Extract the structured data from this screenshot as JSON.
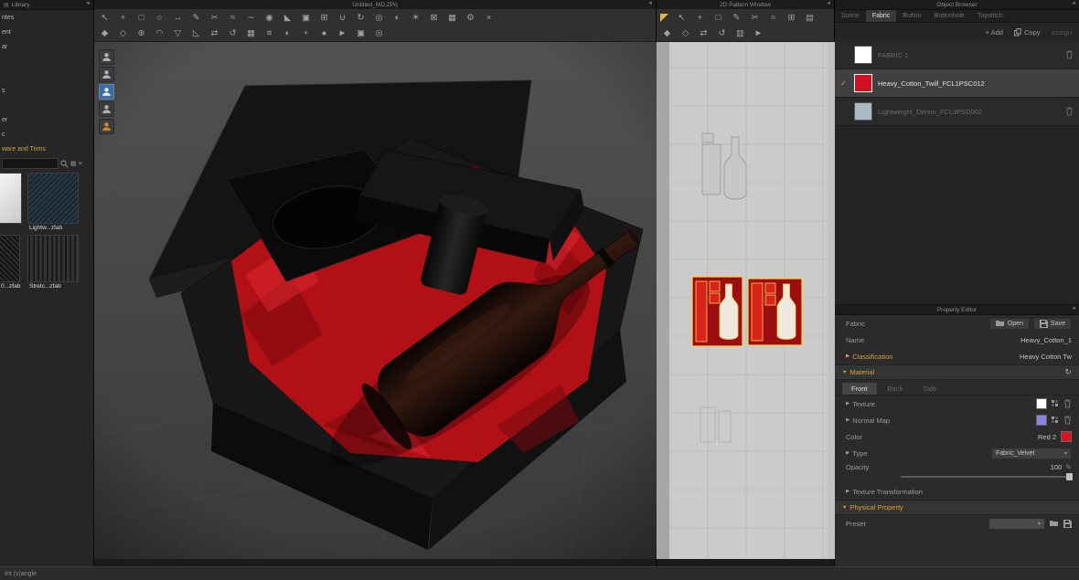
{
  "colors": {
    "accent_orange": "#d9a13c",
    "selection_yellow": "#ffcf40",
    "fabric_red": "#c01016",
    "texture_swatch": "#ffffff",
    "normal_swatch": "#8585e0",
    "color_swatch": "#e01020"
  },
  "library": {
    "title": "Library",
    "items": [
      "rites",
      "ent",
      "ar",
      "",
      "",
      "s",
      "",
      "er",
      "c"
    ],
    "hardware_item": "ware and Trims",
    "search_value": "",
    "thumb1_label": "Lightw...zfab",
    "thumb2_label": "0...zfab",
    "thumb3_label": "Stretc...zfab"
  },
  "viewport3d": {
    "title": "Untitled_MD.ZPrj",
    "tools_row1": [
      {
        "n": "select-tool",
        "g": "↖"
      },
      {
        "n": "move-tool",
        "g": "+"
      },
      {
        "n": "rectangle-select-tool",
        "g": "□"
      },
      {
        "n": "lasso-select-tool",
        "g": "○"
      },
      {
        "n": "scale-tool",
        "g": "↔"
      },
      {
        "n": "pen-tool",
        "g": "✎"
      },
      {
        "n": "scissors-tool",
        "g": "✂"
      },
      {
        "n": "sewing-tool",
        "g": "≈"
      },
      {
        "n": "free-sewing-tool",
        "g": "∼"
      },
      {
        "n": "pin-tool",
        "g": "◉"
      },
      {
        "n": "fold-arrangement-tool",
        "g": "◣"
      },
      {
        "n": "flatten-tool",
        "g": "▣"
      },
      {
        "n": "grid-tool",
        "g": "⊞"
      },
      {
        "n": "tack-tool",
        "g": "∪"
      },
      {
        "n": "rotate-view-tool",
        "g": "↻"
      },
      {
        "n": "zoom-tool",
        "g": "◎"
      },
      {
        "n": "camera-tool",
        "g": "◐"
      },
      {
        "n": "light-tool",
        "g": "☀"
      },
      {
        "n": "render-tool",
        "g": "⊠"
      },
      {
        "n": "texture-tool",
        "g": "▦"
      },
      {
        "n": "settings-tool",
        "g": "⚙"
      },
      {
        "n": "delete-tool",
        "g": "×"
      }
    ],
    "tools_row2": [
      {
        "n": "avatar-tool",
        "g": "◆"
      },
      {
        "n": "gizmo-tool",
        "g": "◇"
      },
      {
        "n": "add-point-tool",
        "g": "⊕"
      },
      {
        "n": "curve-tool",
        "g": "◠"
      },
      {
        "n": "notch-tool",
        "g": "▽"
      },
      {
        "n": "dart-tool",
        "g": "◺"
      },
      {
        "n": "mirror-tool",
        "g": "⇄"
      },
      {
        "n": "undo-history-tool",
        "g": "↺"
      },
      {
        "n": "fabric-view-tool",
        "g": "▦"
      },
      {
        "n": "layer-tool",
        "g": "≡"
      },
      {
        "n": "half-view-tool",
        "g": "◐"
      },
      {
        "n": "add-tool",
        "g": "+"
      },
      {
        "n": "particle-tool",
        "g": "●"
      },
      {
        "n": "simulate-tool",
        "g": "►"
      },
      {
        "n": "pattern-3d-tool",
        "g": "▣"
      },
      {
        "n": "target-tool",
        "g": "◎"
      }
    ]
  },
  "pattern2d": {
    "title": "2D Pattern Window",
    "tools_row1": [
      {
        "n": "select-2d-tool",
        "g": "↖"
      },
      {
        "n": "transform-2d-tool",
        "g": "+"
      },
      {
        "n": "rectangle-2d-tool",
        "g": "□"
      },
      {
        "n": "pen-2d-tool",
        "g": "✎"
      },
      {
        "n": "cut-tool",
        "g": "✂"
      },
      {
        "n": "sew-2d-tool",
        "g": "≈"
      },
      {
        "n": "grid-2d-tool",
        "g": "⊞"
      },
      {
        "n": "pattern-tool",
        "g": "▤"
      }
    ],
    "tools_row2": [
      {
        "n": "diamond-2d-tool",
        "g": "◆"
      },
      {
        "n": "outline-2d-tool",
        "g": "◇"
      },
      {
        "n": "swap-2d-tool",
        "g": "⇄"
      },
      {
        "n": "reset-2d-tool",
        "g": "↺"
      },
      {
        "n": "texture-2d-tool",
        "g": "▥"
      },
      {
        "n": "play-2d-tool",
        "g": "►"
      }
    ]
  },
  "object_browser": {
    "title": "Object Browser",
    "tabs": [
      {
        "label": "Scene"
      },
      {
        "label": "Fabric"
      },
      {
        "label": "Button"
      },
      {
        "label": "Buttonhole"
      },
      {
        "label": "Topstitch"
      }
    ],
    "add_label": "+ Add",
    "copy_label": "Copy",
    "assign_label": "Assign",
    "fabrics": [
      {
        "name": "FABRIC 1",
        "swatch": "#ffffff"
      },
      {
        "name": "Heavy_Cotton_Twill_FCL1PSC012",
        "swatch": "#d01020"
      },
      {
        "name": "Lightweight_Denim_FCL3PSD002",
        "swatch": "#a9bcc4"
      }
    ]
  },
  "property_editor": {
    "title": "Property Editor",
    "fabric_label": "Fabric",
    "open_label": "Open",
    "save_label": "Save",
    "name_label": "Name",
    "name_value": "Heavy_Cotton_1",
    "classification_label": "Classification",
    "classification_value": "Heavy Cotton Tw",
    "material_label": "Material",
    "front_tab": "Front",
    "back_tab": "Back",
    "side_tab": "Side",
    "texture_label": "Texture",
    "normal_map_label": "Normal Map",
    "color_label": "Color",
    "color_value": "Red 2",
    "type_label": "Type",
    "type_value": "Fabric_Velvet",
    "opacity_label": "Opacity",
    "opacity_value": "100",
    "texture_transform_label": "Texture Transformation",
    "physical_label": "Physical Property",
    "preset_label": "Preset"
  },
  "status_bar": {
    "left_text": "Int (v)angle"
  }
}
